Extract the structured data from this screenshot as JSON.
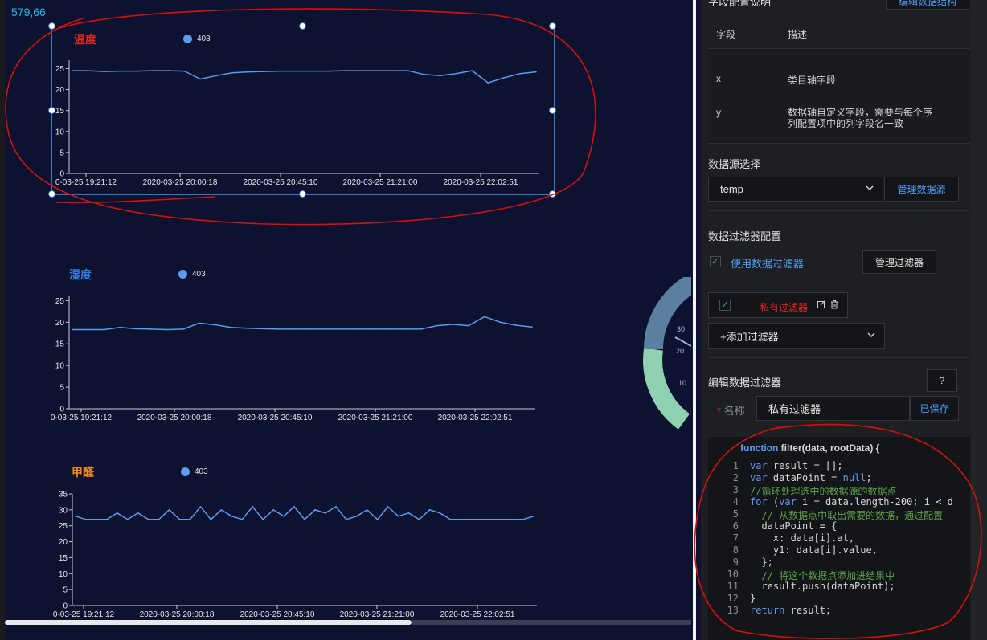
{
  "canvas": {
    "coord_readout": "579,66",
    "charts": [
      {
        "title": "温度",
        "title_color": "#e8261c",
        "legend": "403"
      },
      {
        "title": "湿度",
        "title_color": "#2f7de1",
        "legend": "403"
      },
      {
        "title": "甲醛",
        "title_color": "#f0881e",
        "legend": "403"
      }
    ],
    "x_ticks": [
      "0-03-25 19:21:12",
      "2020-03-25 20:00:18",
      "2020-03-25 20:45:10",
      "2020-03-25 21:21:00",
      "2020-03-25 22:02:51"
    ]
  },
  "chart_data": [
    {
      "type": "line",
      "title": "温度",
      "series": [
        {
          "name": "403",
          "values": [
            24.5,
            24.5,
            24.3,
            24.4,
            24.4,
            24.5,
            24.5,
            24.4,
            22.5,
            23.3,
            24,
            24.2,
            24.3,
            24.4,
            24.4,
            24.4,
            24.4,
            24.5,
            24.5,
            24.5,
            24.5,
            24.5,
            23.6,
            23.3,
            23.8,
            24.5,
            21.6,
            22.8,
            23.8,
            24.2
          ]
        }
      ],
      "yticks": [
        "0",
        "5",
        "10",
        "15",
        "20",
        "25"
      ],
      "ylim": [
        0,
        27
      ]
    },
    {
      "type": "line",
      "title": "湿度",
      "series": [
        {
          "name": "403",
          "values": [
            18.3,
            18.3,
            18.3,
            18.8,
            18.5,
            18.4,
            18.3,
            18.4,
            19.8,
            19.4,
            18.8,
            18.6,
            18.5,
            18.4,
            18.4,
            18.4,
            18.4,
            18.4,
            18.4,
            18.4,
            18.4,
            18.4,
            18.4,
            19.2,
            19.5,
            19.2,
            21.3,
            20,
            19.3,
            18.9
          ]
        }
      ],
      "yticks": [
        "0",
        "5",
        "10",
        "15",
        "20",
        "25"
      ],
      "ylim": [
        0,
        26
      ]
    },
    {
      "type": "line",
      "title": "甲醛",
      "series": [
        {
          "name": "403",
          "values": [
            28,
            27,
            27,
            27,
            29,
            27,
            29,
            27,
            27,
            30,
            27,
            27,
            31,
            27,
            30,
            28,
            27,
            31,
            27,
            30,
            28,
            31,
            27,
            30,
            29,
            31,
            27,
            28,
            30,
            27,
            31,
            28,
            29,
            27,
            30,
            29,
            27,
            27,
            27,
            27,
            27,
            27,
            27,
            27,
            28
          ]
        }
      ],
      "yticks": [
        "0",
        "5",
        "10",
        "15",
        "20",
        "25",
        "30",
        "35"
      ],
      "ylim": [
        0,
        35
      ]
    }
  ],
  "gauge": {
    "labels": [
      "30",
      "20",
      "10"
    ]
  },
  "panel": {
    "top_button": "编辑数据结构",
    "header_partial": "字段配置说明",
    "table_headers": [
      "字段",
      "描述"
    ],
    "table_rows": [
      {
        "field": "x",
        "desc": "类目轴字段"
      },
      {
        "field": "y",
        "desc": "数据轴自定义字段，需要与每个序列配置项中的列字段名一致"
      }
    ],
    "datasource": {
      "label": "数据源选择",
      "value": "temp",
      "manage": "管理数据源"
    },
    "filter_config": {
      "label": "数据过滤器配置",
      "use_label": "使用数据过滤器",
      "manage": "管理过滤器"
    },
    "filter_item": {
      "name": "私有过滤器"
    },
    "add_filter": "+添加过滤器",
    "edit": {
      "label": "编辑数据过滤器",
      "help": "?",
      "name_label": "名称",
      "name_value": "私有过滤器",
      "saved": "已保存"
    },
    "code": {
      "signature": "function filter(data, rootData) {",
      "lines": [
        "var result = [];",
        "var dataPoint = null;",
        "//循环处理选中的数据源的数据点",
        "for (var i = data.length-200; i < d",
        "  // 从数据点中取出需要的数据，通过配置",
        "  dataPoint = {",
        "    x: data[i].at,",
        "    y1: data[i].value,",
        "  };",
        "  // 将这个数据点添加进结果中",
        "  result.push(dataPoint);",
        "}",
        "return result;"
      ]
    }
  },
  "colors": {
    "line": "#5b9bf0",
    "annot": "#d8100b",
    "accent": "#4f9ff2"
  }
}
